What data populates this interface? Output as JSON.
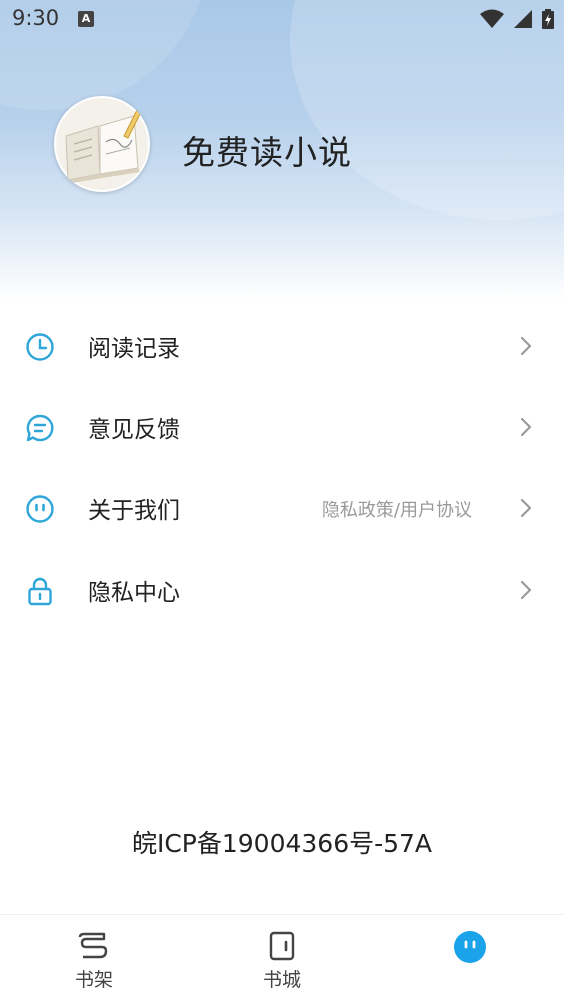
{
  "status_bar": {
    "time": "9:30",
    "notification_glyph": "A",
    "icons": [
      "wifi-icon",
      "signal-icon",
      "battery-charging-icon"
    ]
  },
  "profile": {
    "avatar_icon": "open-book-quill-icon",
    "name": "免费读小说"
  },
  "menu": {
    "items": [
      {
        "label": "阅读记录",
        "icon": "clock-icon",
        "sub": ""
      },
      {
        "label": "意见反馈",
        "icon": "chat-bubble-icon",
        "sub": ""
      },
      {
        "label": "关于我们",
        "icon": "smiley-icon",
        "sub": "隐私政策/用户协议"
      },
      {
        "label": "隐私中心",
        "icon": "lock-icon",
        "sub": ""
      }
    ]
  },
  "icp": "皖ICP备19004366号-57A",
  "bottom_nav": {
    "tabs": [
      {
        "label": "书架",
        "icon": "bookshelf-icon",
        "active": false
      },
      {
        "label": "书城",
        "icon": "bookstore-icon",
        "active": false
      },
      {
        "label": "",
        "icon": "profile-face-icon",
        "active": true
      }
    ]
  },
  "colors": {
    "accent": "#2fa6d8",
    "active_tab": "#1aa3e8",
    "header_top": "#a9c8e8",
    "sub_text": "#9a9a9a"
  }
}
